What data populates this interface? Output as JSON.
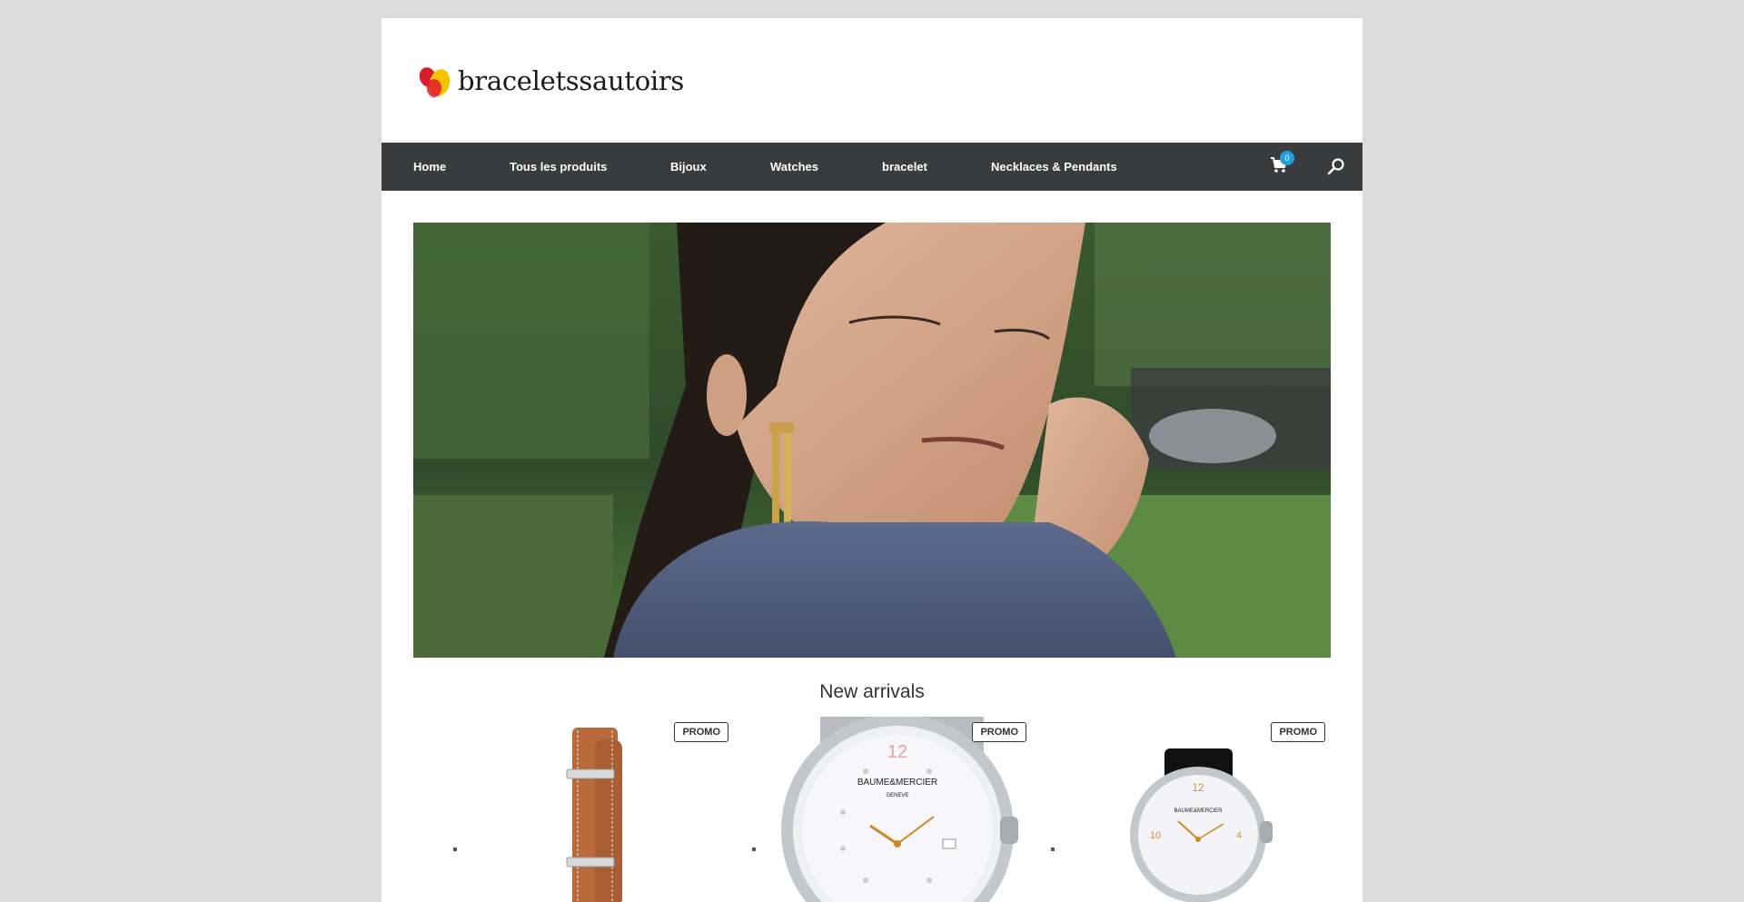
{
  "header": {
    "logo_text": "braceletssautoirs"
  },
  "nav": {
    "items": [
      {
        "label": "Home"
      },
      {
        "label": "Tous les produits"
      },
      {
        "label": "Bijoux"
      },
      {
        "label": "Watches"
      },
      {
        "label": "bracelet"
      },
      {
        "label": "Necklaces & Pendants"
      }
    ],
    "cart_count": "0",
    "cart_icon": "shopping-cart-icon",
    "search_icon": "search-icon"
  },
  "main": {
    "section_title": "New arrivals",
    "products": [
      {
        "badge": "PROMO",
        "image": "leather-strap-bracelet"
      },
      {
        "badge": "PROMO",
        "image": "baume-mercier-steel-watch"
      },
      {
        "badge": "PROMO",
        "image": "baume-mercier-black-strap-watch"
      }
    ]
  },
  "colors": {
    "page_bg": "#dcdcdc",
    "nav_bg": "#3a3b3c",
    "badge_bg": "#1ea0e3"
  }
}
